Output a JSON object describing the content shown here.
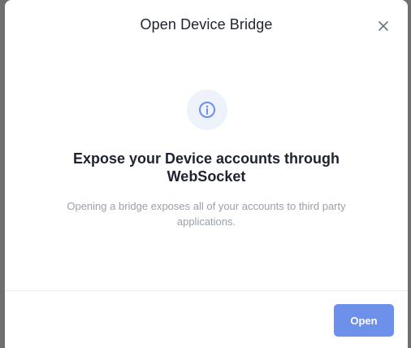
{
  "dialog": {
    "title": "Open Device Bridge",
    "close_icon": "close-icon",
    "info_icon": "info-circle-icon",
    "heading": "Expose your Device accounts through WebSocket",
    "description": "Opening a bridge exposes all of your accounts to third party applications.",
    "open_label": "Open"
  },
  "colors": {
    "accent": "#6d90ea",
    "icon_bg": "#eef2fb",
    "title_text": "#1f2330",
    "muted_text": "#9aa0aa",
    "backdrop": "#6f6f6f"
  }
}
